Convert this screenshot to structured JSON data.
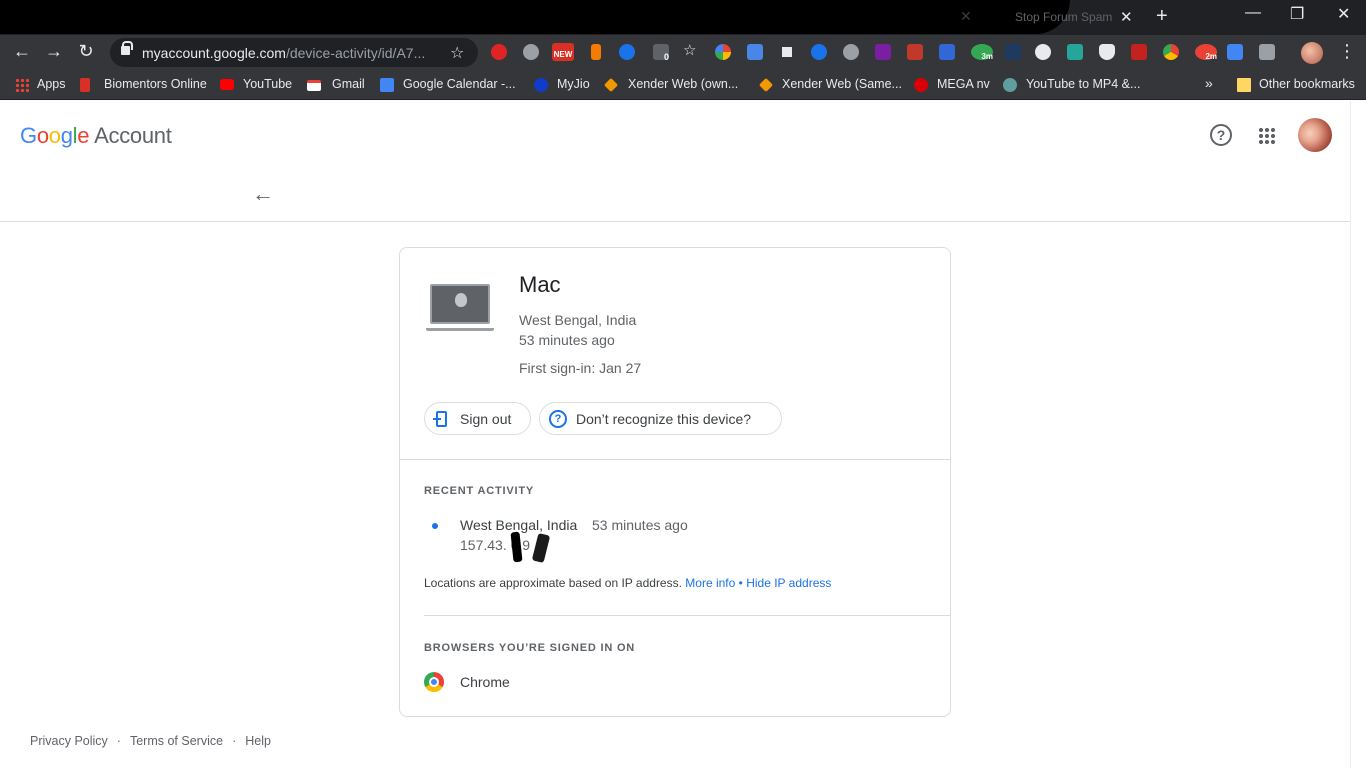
{
  "browser": {
    "tab_title": "Stop Forum Spam",
    "tab_close": "✕",
    "new_tab": "+",
    "url_domain": "myaccount.google.com",
    "url_path": "/device-activity/id/A7...",
    "window_controls": {
      "minimize": "—",
      "restore": "❐",
      "close": "✕"
    },
    "nav": {
      "back": "←",
      "forward": "→",
      "reload": "↻"
    },
    "star": "☆",
    "menu": "⋮",
    "extension_badges": {
      "new": "NEW",
      "count0": "0",
      "badge3m": "3m",
      "badge2m": "2m"
    },
    "bookmarks": [
      {
        "label": "Apps",
        "icon": "apps-grid-icon",
        "color": "#ea4335"
      },
      {
        "label": "Biomentors Online",
        "icon": "biomentors-icon",
        "color": "#d93025"
      },
      {
        "label": "YouTube",
        "icon": "youtube-icon",
        "color": "#ff0000"
      },
      {
        "label": "Gmail",
        "icon": "gmail-icon",
        "color": "#ea4335"
      },
      {
        "label": "Google Calendar -...",
        "icon": "calendar-icon",
        "color": "#4285f4"
      },
      {
        "label": "MyJio",
        "icon": "jio-icon",
        "color": "#0f3cc9"
      },
      {
        "label": "Xender Web (own...",
        "icon": "xender-icon",
        "color": "#f29900"
      },
      {
        "label": "Xender Web (Same...",
        "icon": "xender-icon",
        "color": "#f29900"
      },
      {
        "label": "MEGA nv",
        "icon": "mega-icon",
        "color": "#d90007"
      },
      {
        "label": "YouTube to MP4 &...",
        "icon": "converter-icon",
        "color": "#5f9ea0"
      }
    ],
    "bookmarks_overflow": "»",
    "other_bookmarks": "Other bookmarks"
  },
  "header": {
    "logo_letters": [
      "G",
      "o",
      "o",
      "g",
      "l",
      "e"
    ],
    "logo_colors": [
      "#4285f4",
      "#ea4335",
      "#fbbc04",
      "#4285f4",
      "#34a853",
      "#ea4335"
    ],
    "product": "Account",
    "help_icon": "?",
    "back": "←"
  },
  "device": {
    "name": "Mac",
    "location": "West Bengal, India",
    "last_seen": "53 minutes ago",
    "first_signin": "First sign-in: Jan 27",
    "sign_out_label": "Sign out",
    "dont_recognize_label": "Don’t recognize this device?",
    "help_glyph": "?"
  },
  "recent_activity": {
    "title": "RECENT ACTIVITY",
    "items": [
      {
        "location": "West Bengal, India",
        "time": "53 minutes ago",
        "ip": "157.43.  6.9"
      }
    ],
    "note": "Locations are approximate based on IP address.",
    "more_info": "More info",
    "bullet": " • ",
    "hide_ip": "Hide IP address"
  },
  "browsers": {
    "title": "BROWSERS YOU’RE SIGNED IN ON",
    "items": [
      {
        "name": "Chrome"
      }
    ]
  },
  "footer": {
    "privacy": "Privacy Policy",
    "terms": "Terms of Service",
    "help": "Help",
    "sep": "·"
  }
}
